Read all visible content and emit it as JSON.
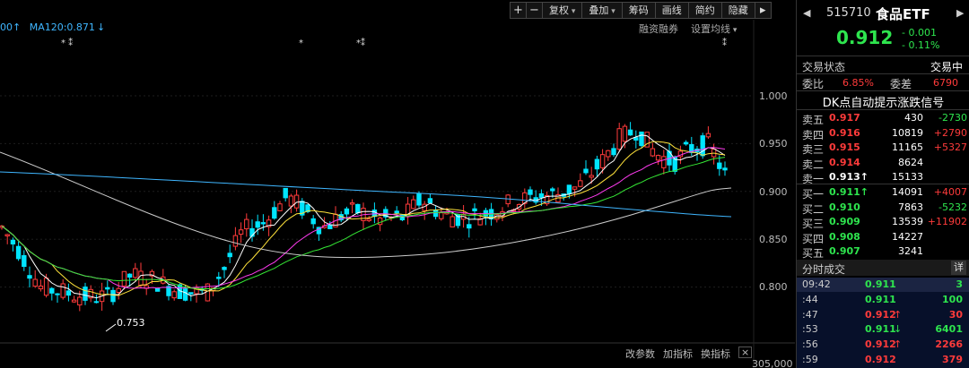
{
  "toolbar": {
    "items": [
      "+",
      "−",
      "复权",
      "叠加",
      "筹码",
      "画线",
      "简约",
      "隐藏"
    ],
    "more": "▸"
  },
  "legend": {
    "ma_prefix": "00",
    "ma_prefix_arrow": "↑",
    "ma120": "MA120:0.871",
    "ma120_arrow": "↓"
  },
  "top_links": {
    "margin": "融资融券",
    "settings": "设置均线"
  },
  "markers": [
    "* ⁑",
    "*",
    "*⁑",
    "⁑"
  ],
  "price_axis": [
    "1.000",
    "0.950",
    "0.900",
    "0.850",
    "0.800"
  ],
  "low_label": "0.753",
  "bottom_links": [
    "改参数",
    "加指标",
    "换指标"
  ],
  "bottom_close": "×",
  "volume_axis": "305,000",
  "colors": {
    "up": "#ff3b3b",
    "down": "#00e5ff",
    "ma5": "#ffffff",
    "ma10": "#ffe23b",
    "ma20": "#ff3bf0",
    "ma30": "#35e835",
    "ma60": "#cccccc",
    "ma120": "#3fb6ff"
  },
  "header": {
    "code": "515710",
    "name": "食品ETF",
    "price": "0.912",
    "change": "- 0.001",
    "change_pct": "- 0.11%",
    "nav_left": "◀",
    "nav_right": "▶"
  },
  "status": {
    "label": "交易状态",
    "value": "交易中"
  },
  "ratio": {
    "label1": "委比",
    "value1": "6.85%",
    "label2": "委差",
    "value2": "6790"
  },
  "dk_title": "DK点自动提示涨跌信号",
  "asks": [
    {
      "name": "卖五",
      "price": "0.917",
      "vol": "430",
      "chg": "-2730",
      "chg_color": "green",
      "price_color": "red"
    },
    {
      "name": "卖四",
      "price": "0.916",
      "vol": "10819",
      "chg": "+2790",
      "chg_color": "red",
      "price_color": "red"
    },
    {
      "name": "卖三",
      "price": "0.915",
      "vol": "11165",
      "chg": "+5327",
      "chg_color": "red",
      "price_color": "red"
    },
    {
      "name": "卖二",
      "price": "0.914",
      "vol": "8624",
      "chg": "",
      "chg_color": "red",
      "price_color": "red"
    },
    {
      "name": "卖一",
      "price": "0.913↑",
      "vol": "15133",
      "chg": "",
      "chg_color": "red",
      "price_color": "white"
    }
  ],
  "bids": [
    {
      "name": "买一",
      "price": "0.911↑",
      "vol": "14091",
      "chg": "+4007",
      "chg_color": "red",
      "price_color": "green"
    },
    {
      "name": "买二",
      "price": "0.910",
      "vol": "7863",
      "chg": "-5232",
      "chg_color": "green",
      "price_color": "green"
    },
    {
      "name": "买三",
      "price": "0.909",
      "vol": "13539",
      "chg": "+11902",
      "chg_color": "red",
      "price_color": "green"
    },
    {
      "name": "买四",
      "price": "0.908",
      "vol": "14227",
      "chg": "",
      "chg_color": "red",
      "price_color": "green"
    },
    {
      "name": "买五",
      "price": "0.907",
      "vol": "3241",
      "chg": "",
      "chg_color": "red",
      "price_color": "green"
    }
  ],
  "trades_header": {
    "title": "分时成交",
    "detail": "详"
  },
  "trades": [
    {
      "time": "09:42",
      "price": "0.911",
      "arrow": "",
      "vol": "3",
      "color": "green"
    },
    {
      "time": ":44",
      "price": "0.911",
      "arrow": "",
      "vol": "100",
      "color": "green"
    },
    {
      "time": ":47",
      "price": "0.912",
      "arrow": "↑",
      "vol": "30",
      "color": "red"
    },
    {
      "time": ":53",
      "price": "0.911",
      "arrow": "↓",
      "vol": "6401",
      "color": "green"
    },
    {
      "time": ":56",
      "price": "0.912",
      "arrow": "↑",
      "vol": "2266",
      "color": "red"
    },
    {
      "time": ":59",
      "price": "0.912",
      "arrow": "",
      "vol": "379",
      "color": "red"
    }
  ]
}
